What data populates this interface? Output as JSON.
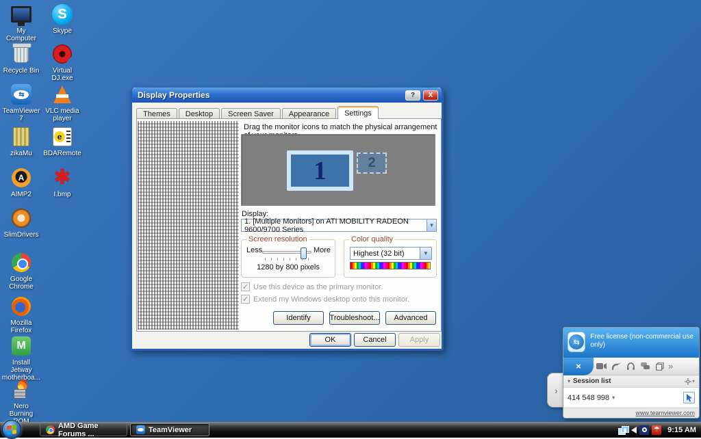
{
  "colors": {
    "desktop_blue": "#2e6bb0",
    "titlebar_blue": "#2f6fd0",
    "dialog_frame_blue": "#2660b8",
    "group_caption": "#99452c",
    "teamviewer_header_blue": "#2a86d4",
    "taskbar_black": "#111111",
    "monitor_fill": "#3e73a9",
    "close_button_red": "#cf3a28"
  },
  "desktop": {
    "icons": [
      {
        "id": "my-computer",
        "label": "My Computer"
      },
      {
        "id": "skype",
        "label": "Skype",
        "glyph": "S"
      },
      {
        "id": "recycle-bin",
        "label": "Recycle Bin"
      },
      {
        "id": "virtual-dj",
        "label": "Virtual DJ.exe"
      },
      {
        "id": "teamviewer-7",
        "label": "TeamViewer 7"
      },
      {
        "id": "vlc-media-player",
        "label": "VLC media player"
      },
      {
        "id": "zikamu",
        "label": "zikaMu"
      },
      {
        "id": "bdaremote",
        "label": "BDARemote",
        "glyph": "e"
      },
      {
        "id": "aimp2",
        "label": "AIMP2",
        "glyph": "A"
      },
      {
        "id": "i-bmp",
        "label": "I.bmp",
        "glyph": "✱"
      },
      {
        "id": "slimdrivers",
        "label": "SlimDrivers"
      },
      {
        "id": "google-chrome",
        "label": "Google Chrome"
      },
      {
        "id": "mozilla-firefox",
        "label": "Mozilla Firefox"
      },
      {
        "id": "install-jetway",
        "label": "Install Jetway motherboa...",
        "glyph": "M"
      },
      {
        "id": "nero-burning-rom",
        "label": "Nero Burning ROM Porta..."
      }
    ]
  },
  "dialog": {
    "title": "Display Properties",
    "help_button": "?",
    "close_button": "X",
    "tabs": [
      "Themes",
      "Desktop",
      "Screen Saver",
      "Appearance",
      "Settings"
    ],
    "active_tab": "Settings",
    "instruction": "Drag the monitor icons to match the physical arrangement of your monitors.",
    "monitors": {
      "primary": "1",
      "secondary": "2"
    },
    "display_label": "Display:",
    "display_value": "1. [Multiple Monitors] on ATI MOBILITY RADEON 9600/9700 Series",
    "dropdown_arrow": "▼",
    "resolution_group": {
      "title": "Screen resolution",
      "less": "Less",
      "more": "More",
      "value": "1280 by 800 pixels"
    },
    "color_group": {
      "title": "Color quality",
      "value": "Highest (32 bit)"
    },
    "checkbox_primary": "Use this device as the primary monitor.",
    "checkbox_extend": "Extend my Windows desktop onto this monitor.",
    "checkmark": "✓",
    "buttons": {
      "identify": "Identify",
      "troubleshoot": "Troubleshoot...",
      "advanced": "Advanced",
      "ok": "OK",
      "cancel": "Cancel",
      "apply": "Apply"
    }
  },
  "teamviewer": {
    "license_text": "Free license (non-commercial use only)",
    "logo_glyph": "⇆",
    "close_label": "×",
    "toolbar_icons": [
      "video-camera",
      "phone",
      "headset",
      "chat",
      "copy",
      "more"
    ],
    "more_glyph": "»",
    "session_list_label": "Session list",
    "session_caret": "▾",
    "session_id": "414 548 998",
    "link": "www.teamviewer.com",
    "handle_glyph": "›"
  },
  "taskbar": {
    "tasks": [
      {
        "id": "amd-game-forums",
        "label": "AMD Game Forums ..."
      },
      {
        "id": "teamviewer",
        "label": "TeamViewer"
      }
    ],
    "tray_avira_glyph": "☂",
    "clock": "9:15 AM"
  }
}
